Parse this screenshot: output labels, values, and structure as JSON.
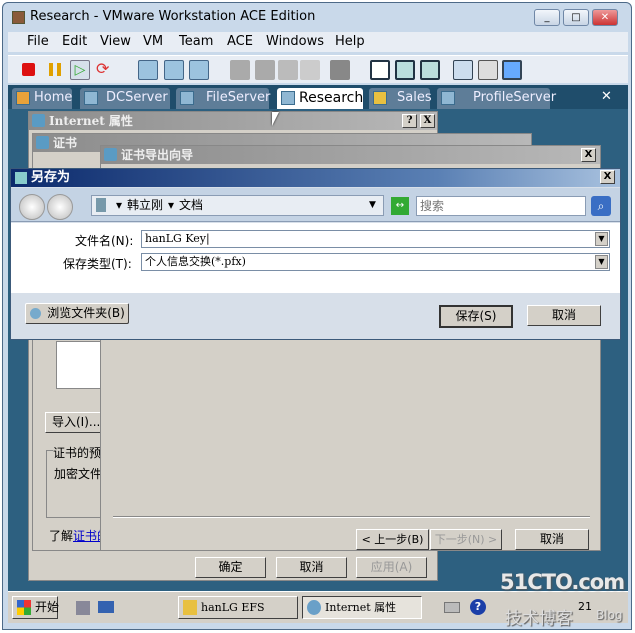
{
  "app": {
    "title": "Research - VMware Workstation ACE Edition"
  },
  "menu": [
    "File",
    "Edit",
    "View",
    "VM",
    "Team",
    "ACE",
    "Windows",
    "Help"
  ],
  "tabs": [
    {
      "label": "Home"
    },
    {
      "label": "DCServer"
    },
    {
      "label": "FileServer"
    },
    {
      "label": "Research",
      "active": true
    },
    {
      "label": "Sales"
    },
    {
      "label": "ProfileServer"
    }
  ],
  "close_tabs": "✕",
  "internet_props": {
    "title": "Internet 属性",
    "help": "?",
    "close": "X",
    "ok": "确定",
    "cancel": "取消",
    "apply": "应用(A)"
  },
  "cert": {
    "title": "证书",
    "import": "导入(I)...",
    "group_label": "证书的预",
    "group_text": "加密文件",
    "learn_prefix": "了解",
    "learn_link": "证书的"
  },
  "wizard": {
    "title": "证书导出向导",
    "close": "X",
    "back": "< 上一步(B)",
    "next": "下一步(N) >",
    "cancel": "取消"
  },
  "saveas": {
    "title": "另存为",
    "close": "X",
    "breadcrumb": [
      "韩立刚",
      "文档"
    ],
    "search_placeholder": "搜索",
    "filename_label": "文件名(N):",
    "filename_value": "hanLG Key",
    "type_label": "保存类型(T):",
    "type_value": "个人信息交换(*.pfx)",
    "browse": "浏览文件夹(B)",
    "save": "保存(S)",
    "cancel": "取消"
  },
  "taskbar": {
    "start": "开始",
    "items": [
      "hanLG EFS",
      "Internet 属性"
    ],
    "clock": "21"
  },
  "watermark": {
    "line1": "51CTO.com",
    "line2": "技术博客",
    "line3": "Blog"
  },
  "colors": {
    "title_bar": "#0c2a6c",
    "vm_background": "#2d6080",
    "tab_strip": "#1f4d6b"
  }
}
